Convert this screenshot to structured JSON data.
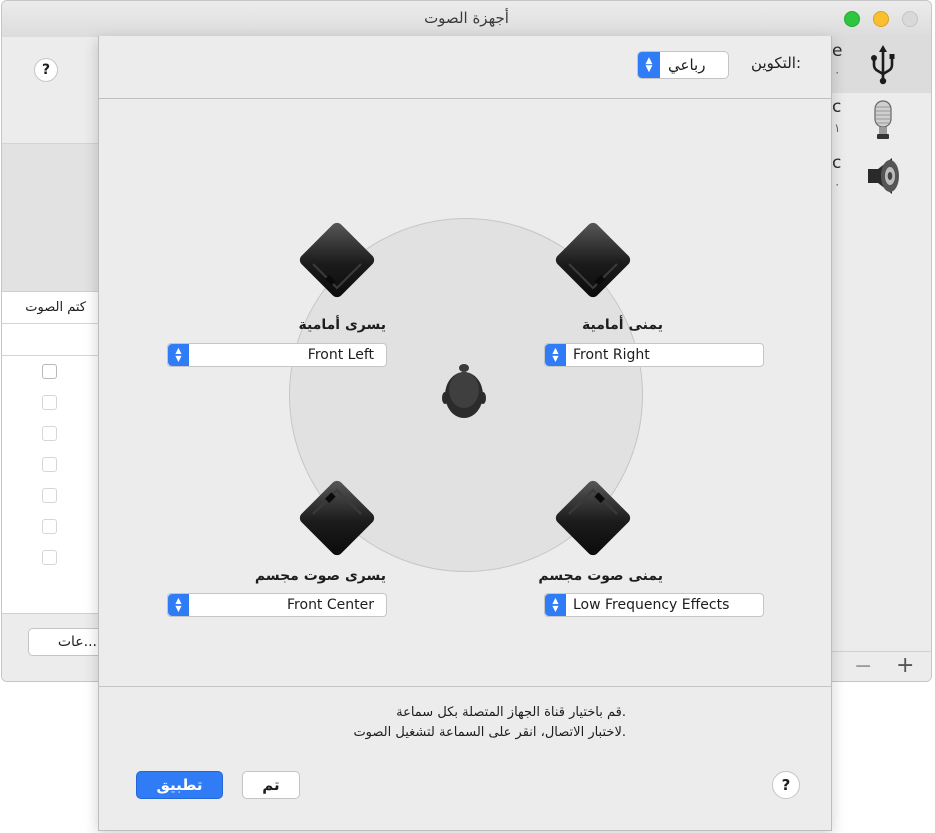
{
  "window": {
    "title": "أجهزة الصوت",
    "help_symbol": "?",
    "mute_column_label": "كتم الصوت",
    "more_button_label": "عات...",
    "devices": [
      {
        "name": "e",
        "sub": "٠",
        "icon": "usb-icon",
        "selected": true
      },
      {
        "name": "c",
        "sub": "١",
        "icon": "microphone-icon",
        "selected": false
      },
      {
        "name": "c",
        "sub": "٠",
        "icon": "speaker-icon",
        "selected": false
      }
    ],
    "remove_symbol": "−",
    "add_symbol": "+"
  },
  "sheet": {
    "configuration_label": "التكوين:",
    "configuration_value": "رباعي",
    "speakers": {
      "front_left": {
        "label": "يسرى أمامية",
        "channel": "Front Left"
      },
      "front_right": {
        "label": "يمنى أمامية",
        "channel": "Front Right"
      },
      "surround_left": {
        "label": "يسرى صوت مجسم",
        "channel": "Front Center"
      },
      "surround_right": {
        "label": "يمنى صوت مجسم",
        "channel": "Low Frequency Effects"
      }
    },
    "instruction_line1": "قم باختيار قناة الجهاز المتصلة بكل سماعة.",
    "instruction_line2": "لاختبار الاتصال، انقر على السماعة لتشغيل الصوت.",
    "help_symbol": "?",
    "done_label": "تم",
    "apply_label": "تطبيق"
  },
  "colors": {
    "accent": "#2f7cf6",
    "traffic_green": "#2dc63f",
    "traffic_yellow": "#f9bf2d"
  }
}
